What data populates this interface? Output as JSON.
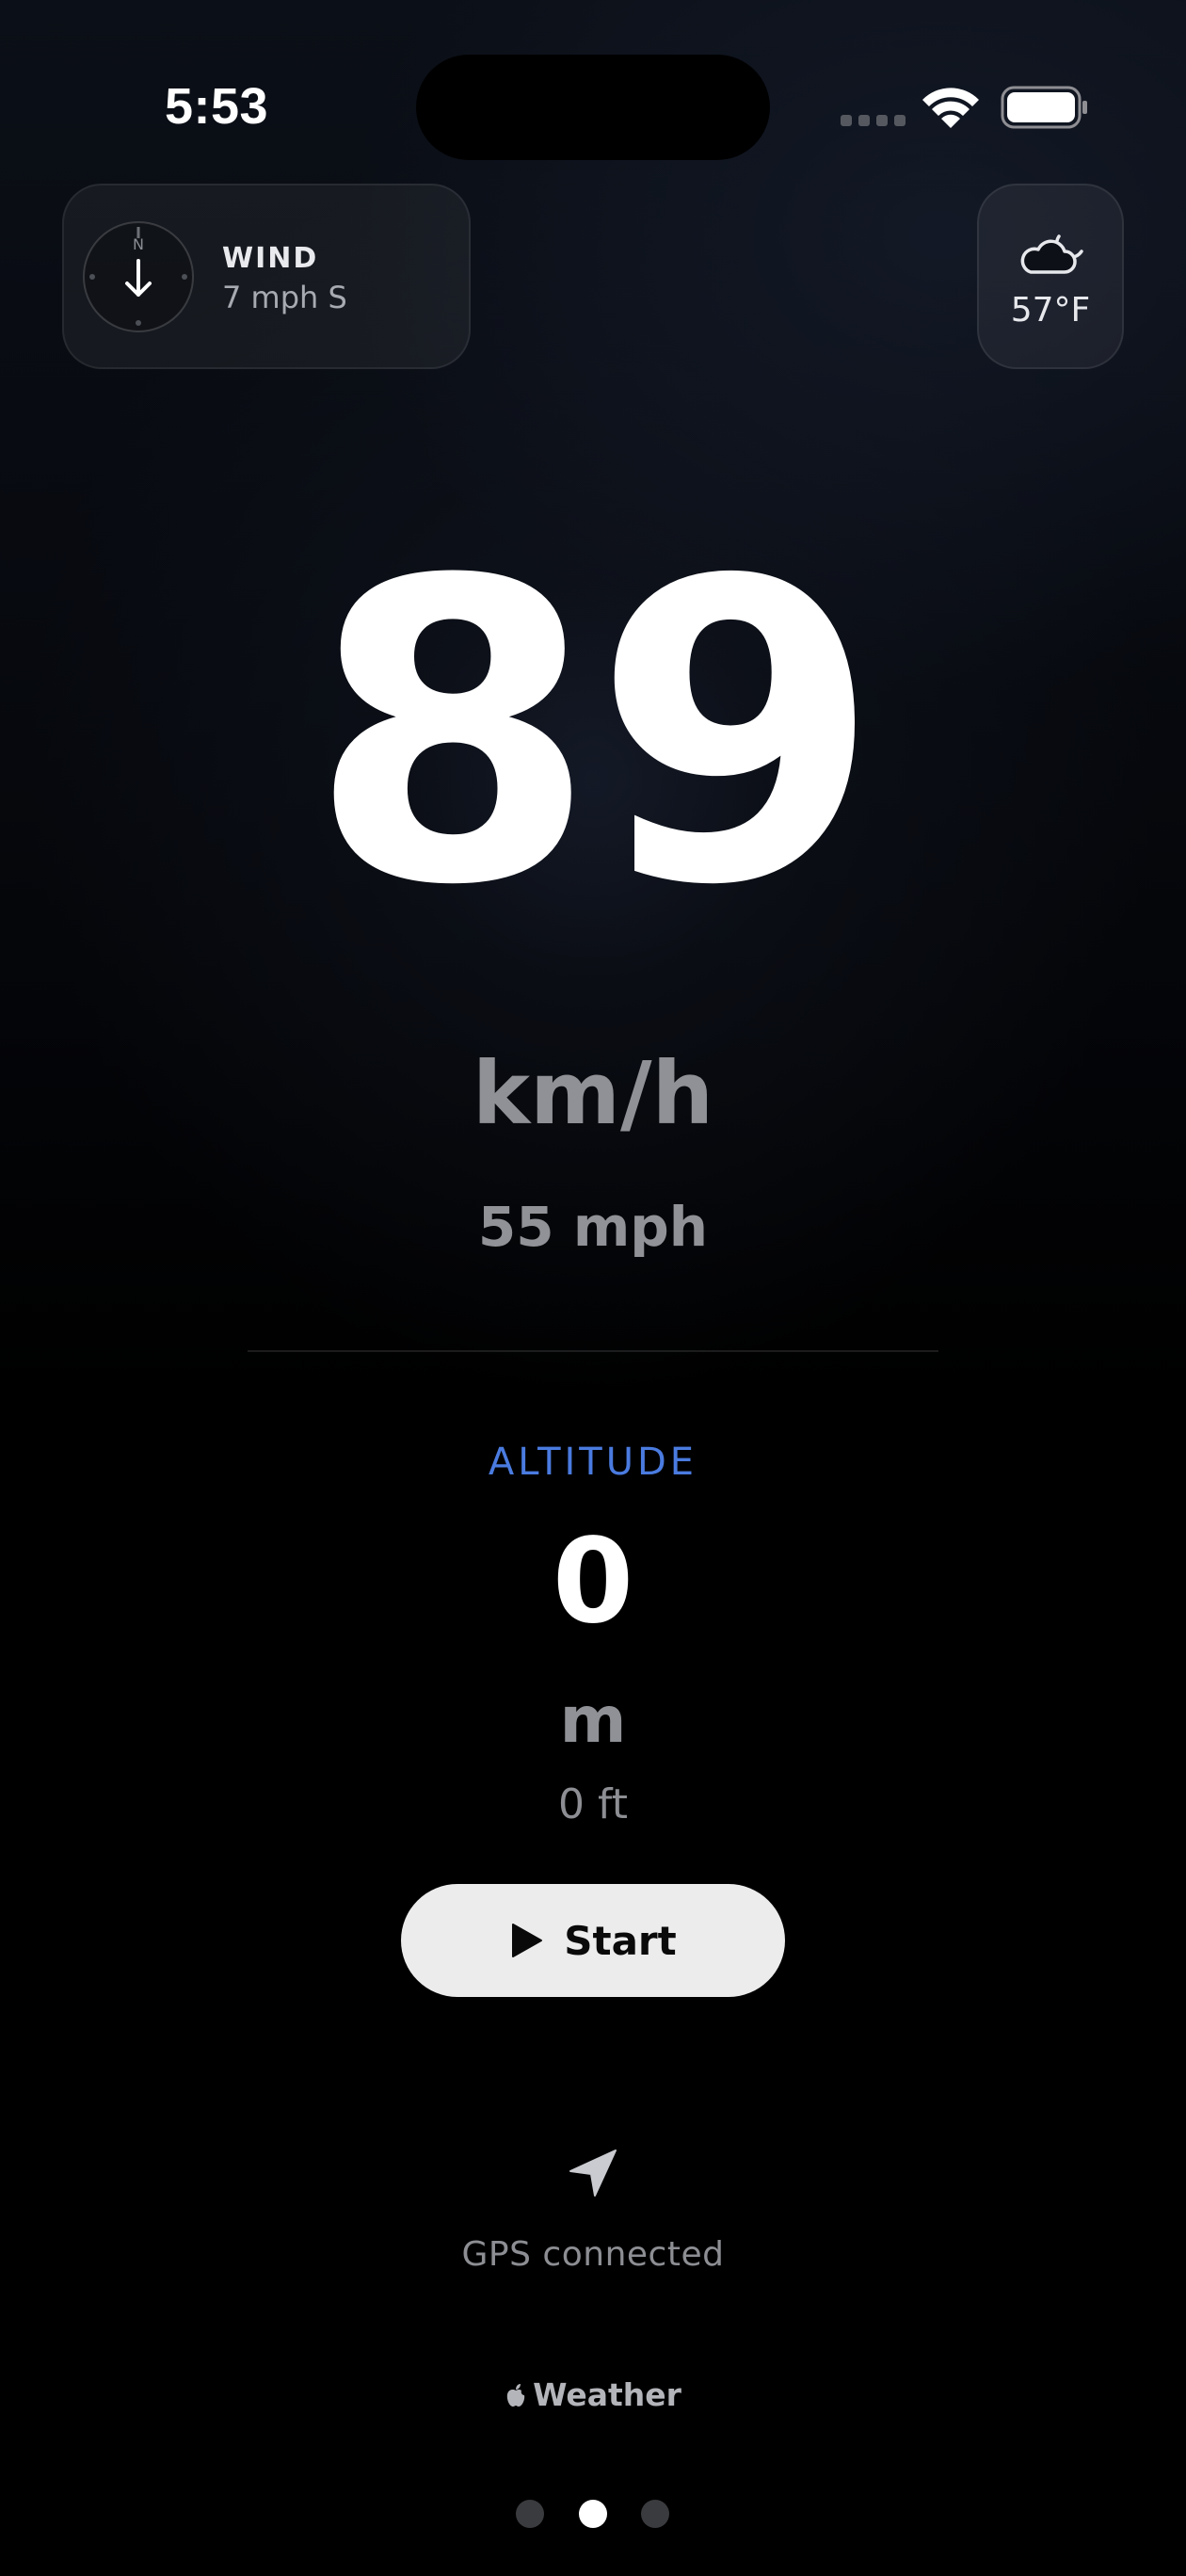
{
  "status_bar": {
    "time": "5:53"
  },
  "wind": {
    "compass_north": "N",
    "title": "WIND",
    "value": "7 mph S"
  },
  "weather": {
    "icon": "cloud-moon-icon",
    "temperature": "57°F"
  },
  "speed": {
    "value": "89",
    "unit": "km/h",
    "secondary": "55 mph"
  },
  "altitude": {
    "label": "ALTITUDE",
    "value": "0",
    "unit": "m",
    "secondary": "0 ft"
  },
  "controls": {
    "start_label": "Start"
  },
  "gps": {
    "icon": "location-arrow-icon",
    "status": "GPS connected"
  },
  "attribution": {
    "label": "Weather"
  },
  "pagination": {
    "total": 3,
    "active_index": 1
  },
  "colors": {
    "accent": "#4a7be0",
    "button_bg": "#ececec"
  }
}
